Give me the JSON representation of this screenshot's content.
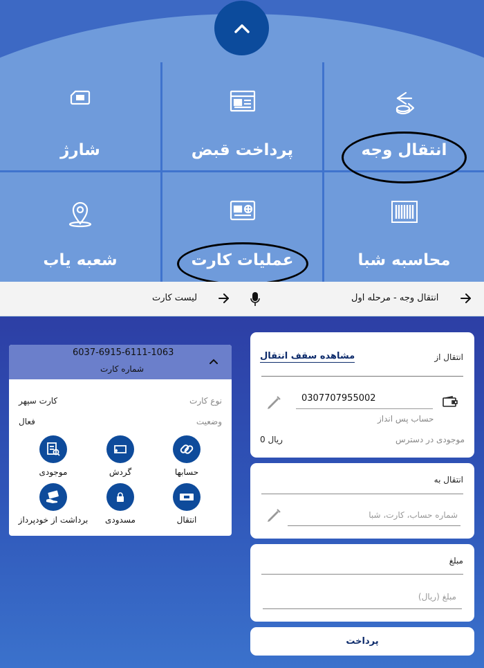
{
  "menu": {
    "tiles": [
      {
        "label": "انتقال وجه",
        "icon": "money-transfer-icon"
      },
      {
        "label": "پرداخت قبض",
        "icon": "bill-icon"
      },
      {
        "label": "شارژ",
        "icon": "sim-card-icon"
      },
      {
        "label": "محاسبه شبا",
        "icon": "barcode-icon"
      },
      {
        "label": "عملیات کارت",
        "icon": "bank-card-icon"
      },
      {
        "label": "شعبه یاب",
        "icon": "location-pin-icon"
      }
    ],
    "toggle_icon": "chevron-up-icon"
  },
  "left_header": {
    "title": "لیست کارت",
    "arrow_icon": "arrow-right-icon",
    "mic_icon": "microphone-icon"
  },
  "right_header": {
    "title": "انتقال وجه - مرحله اول",
    "arrow_icon": "arrow-right-icon"
  },
  "card_panel": {
    "card_number": "6037-6915-6111-1063",
    "card_number_label": "شماره کارت",
    "type_label": "نوع کارت",
    "type_value": "کارت سپهر",
    "status_label": "وضعیت",
    "status_value": "فعال",
    "actions": [
      {
        "label": "حسابها",
        "icon": "link-icon"
      },
      {
        "label": "گردش",
        "icon": "transactions-icon"
      },
      {
        "label": "موجودی",
        "icon": "balance-icon"
      },
      {
        "label": "انتقال",
        "icon": "transfer-icon"
      },
      {
        "label": "مسدودی",
        "icon": "lock-icon"
      },
      {
        "label": "برداشت از خودپرداز",
        "icon": "atm-withdraw-icon"
      }
    ]
  },
  "transfer_from": {
    "label": "انتقال از",
    "limit_link": "مشاهده سقف انتقال",
    "account_number": "0307707955002",
    "account_type": "حساب پس انداز",
    "balance_label": "موجودی در دسترس",
    "balance_value": "0 ریال"
  },
  "transfer_to": {
    "label": "انتقال به",
    "placeholder": "شماره حساب، کارت، شبا"
  },
  "amount": {
    "label": "مبلغ",
    "placeholder": "مبلغ (ریال)"
  },
  "pay_button": "پرداخت"
}
